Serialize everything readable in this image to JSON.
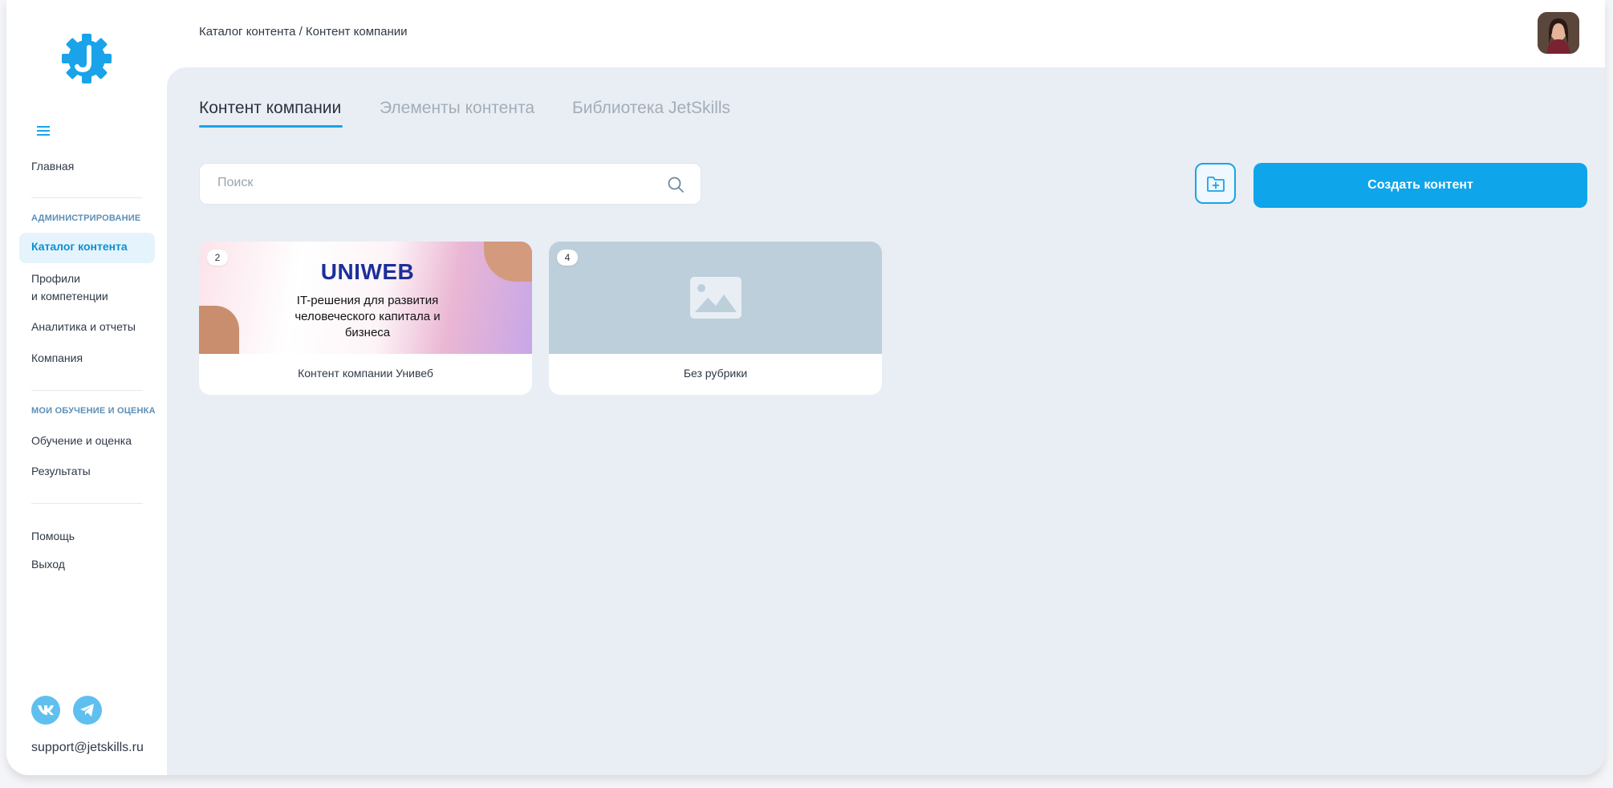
{
  "sidebar": {
    "items": {
      "home": "Главная",
      "admin_section": "АДМИНИСТРИРОВАНИЕ",
      "catalog": "Каталог контента",
      "profiles_line1": "Профили",
      "profiles_line2": "и компетенции",
      "analytics": "Аналитика и отчеты",
      "company": "Компания",
      "learning_section": "МОИ ОБУЧЕНИЕ И ОЦЕНКА",
      "learning": "Обучение и оценка",
      "results": "Результаты",
      "help": "Помощь",
      "logout": "Выход"
    },
    "social": {
      "vk": "vk",
      "telegram": "telegram-icon"
    },
    "support_email": "support@jetskills.ru"
  },
  "header": {
    "breadcrumb": "Каталог контента / Контент компании",
    "avatar": "user-avatar"
  },
  "tabs": [
    {
      "label": "Контент компании",
      "active": true
    },
    {
      "label": "Элементы контента",
      "active": false
    },
    {
      "label": "Библиотека JetSkills",
      "active": false
    }
  ],
  "toolbar": {
    "search_placeholder": "Поиск",
    "create_label": "Создать контент"
  },
  "cards": [
    {
      "count": "2",
      "title": "Контент компании Унивеб",
      "banner_brand": "UNIWEB",
      "banner_text": "IT-решения для развития человеческого капитала и бизнеса"
    },
    {
      "count": "4",
      "title": "Без рубрики"
    }
  ],
  "colors": {
    "accent": "#1aa3e8",
    "primary_button": "#0fa5ea",
    "main_background": "#e9eef4"
  }
}
